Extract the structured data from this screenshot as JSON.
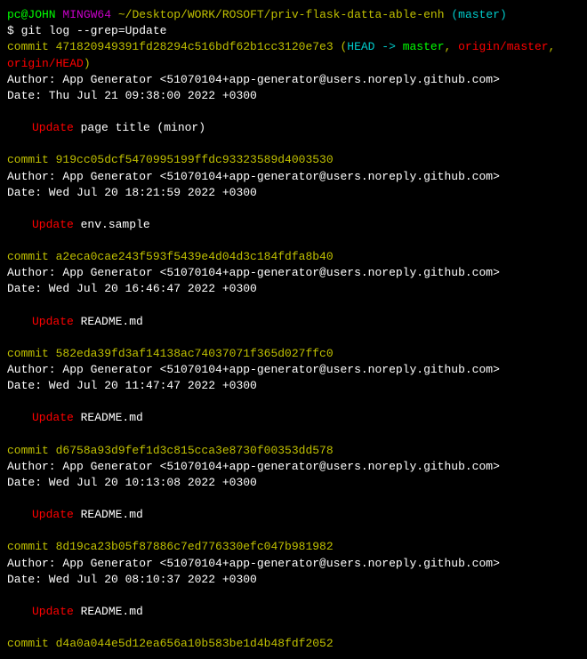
{
  "prompt": {
    "user": "pc@JOHN",
    "host": "MINGW64",
    "path": "~/Desktop/WORK/ROSOFT/priv-flask-datta-able-enh",
    "branch_open": "(",
    "branch": "master",
    "branch_close": ")"
  },
  "command": {
    "prefix": "$ ",
    "text": "git log --grep=Update"
  },
  "commits": [
    {
      "label": "commit ",
      "hash": "471820949391fd28294c516bdf62b1cc3120e7e3",
      "refs_open": " (",
      "head": "HEAD -> ",
      "master": "master",
      "sep1": ", ",
      "origin_master": "origin/master",
      "sep2": ", ",
      "origin_head": "origin/HEAD",
      "refs_close": ")",
      "author": "Author: App Generator <51070104+app-generator@users.noreply.github.com>",
      "date": "Date:   Thu Jul 21 09:38:00 2022 +0300",
      "msg_keyword": "Update ",
      "msg_rest": "page title (minor)"
    },
    {
      "label": "commit ",
      "hash": "919cc05dcf5470995199ffdc93323589d4003530",
      "author": "Author: App Generator <51070104+app-generator@users.noreply.github.com>",
      "date": "Date:   Wed Jul 20 18:21:59 2022 +0300",
      "msg_keyword": "Update ",
      "msg_rest": "env.sample"
    },
    {
      "label": "commit ",
      "hash": "a2eca0cae243f593f5439e4d04d3c184fdfa8b40",
      "author": "Author: App Generator <51070104+app-generator@users.noreply.github.com>",
      "date": "Date:   Wed Jul 20 16:46:47 2022 +0300",
      "msg_keyword": "Update ",
      "msg_rest": "README.md"
    },
    {
      "label": "commit ",
      "hash": "582eda39fd3af14138ac74037071f365d027ffc0",
      "author": "Author: App Generator <51070104+app-generator@users.noreply.github.com>",
      "date": "Date:   Wed Jul 20 11:47:47 2022 +0300",
      "msg_keyword": "Update ",
      "msg_rest": "README.md"
    },
    {
      "label": "commit ",
      "hash": "d6758a93d9fef1d3c815cca3e8730f00353dd578",
      "author": "Author: App Generator <51070104+app-generator@users.noreply.github.com>",
      "date": "Date:   Wed Jul 20 10:13:08 2022 +0300",
      "msg_keyword": "Update ",
      "msg_rest": "README.md"
    },
    {
      "label": "commit ",
      "hash": "8d19ca23b05f87886c7ed776330efc047b981982",
      "author": "Author: App Generator <51070104+app-generator@users.noreply.github.com>",
      "date": "Date:   Wed Jul 20 08:10:37 2022 +0300",
      "msg_keyword": "Update ",
      "msg_rest": "README.md"
    },
    {
      "label": "commit ",
      "hash": "d4a0a044e5d12ea656a10b583be1d4b48fdf2052"
    }
  ]
}
